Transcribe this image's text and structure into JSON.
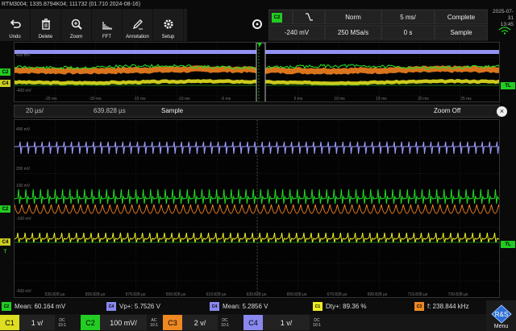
{
  "titlebar": "RTM3004; 1335.8794K04; 111732 (01.710 2024-08-16)",
  "toolbar": [
    {
      "label": "Undo",
      "icon": "undo-icon"
    },
    {
      "label": "Delete",
      "icon": "trash-icon"
    },
    {
      "label": "Zoom",
      "icon": "zoom-icon"
    },
    {
      "label": "FFT",
      "icon": "fft-icon"
    },
    {
      "label": "Annotation",
      "icon": "annotation-icon"
    },
    {
      "label": "Setup",
      "icon": "gear-icon"
    }
  ],
  "acquisition": {
    "trigger_source": "C2",
    "trigger_slope": "falling-edge",
    "trigger_mode": "Norm",
    "timebase": "5 ms/",
    "state": "Complete",
    "trigger_level": "-240 mV",
    "sample_rate": "250 MSa/s",
    "position": "0 s",
    "acq_mode": "Sample"
  },
  "datetime": {
    "date": "2025-07-31",
    "time": "13:45"
  },
  "overview": {
    "left_markers": [
      {
        "id": "C2",
        "color": "#22cc22"
      },
      {
        "id": "C4",
        "color": "#cccc22"
      }
    ],
    "right_marker": "TL",
    "y_labels": [
      "400 mV",
      "-400 mV"
    ],
    "x_labels": [
      "-25 ms",
      "-20 ms",
      "-15 ms",
      "-10 ms",
      "-5 ms",
      "5 ms",
      "10 ms",
      "15 ms",
      "20 ms",
      "25 ms"
    ]
  },
  "zoom": {
    "scale": "20 µs/",
    "position": "639.828 µs",
    "mode": "Sample",
    "off_label": "Zoom Off",
    "close": "×"
  },
  "main": {
    "y_labels": [
      "400 mV",
      "200 mV",
      "100 mV",
      "-100 mV",
      "-500 mV"
    ],
    "x_labels": [
      "539.828 µs",
      "559.828 µs",
      "579.828 µs",
      "599.828 µs",
      "619.828 µs",
      "639.828 µs",
      "659.828 µs",
      "679.828 µs",
      "699.828 µs",
      "719.828 µs",
      "739.828 µs"
    ],
    "left_markers": [
      "C2",
      "C4",
      "T"
    ],
    "right_marker": "TL"
  },
  "measurements": [
    {
      "badge": "C2",
      "color": "#22cc22",
      "text": "Mean: 60.164 mV"
    },
    {
      "badge": "C4",
      "color": "#8888ee",
      "text": "Vp+: 5.7526 V"
    },
    {
      "badge": "C4",
      "color": "#8888ee",
      "text": "Mean: 5.2856 V"
    },
    {
      "badge": "C1",
      "color": "#eeee22",
      "text": "Dty+: 89.36 %"
    },
    {
      "badge": "C3",
      "color": "#ee8822",
      "text": "f: 238.844 kHz"
    }
  ],
  "channels": [
    {
      "tag": "C1",
      "color": "#dddd22",
      "value": "1 v/",
      "meta": "DC",
      "sub": "10:1"
    },
    {
      "tag": "C2",
      "color": "#22cc22",
      "value": "100 mV/",
      "meta": "AC",
      "sub": "10:1"
    },
    {
      "tag": "C3",
      "color": "#ee8822",
      "value": "2 v/",
      "meta": "DC",
      "sub": "10:1"
    },
    {
      "tag": "C4",
      "color": "#8888ee",
      "value": "1 v/",
      "meta": "DC",
      "sub": "10:1"
    }
  ],
  "menu_label": "Menu",
  "colors": {
    "ch1": "#eeee22",
    "ch2": "#22dd22",
    "ch3": "#ff8822",
    "ch4": "#9999ff"
  }
}
